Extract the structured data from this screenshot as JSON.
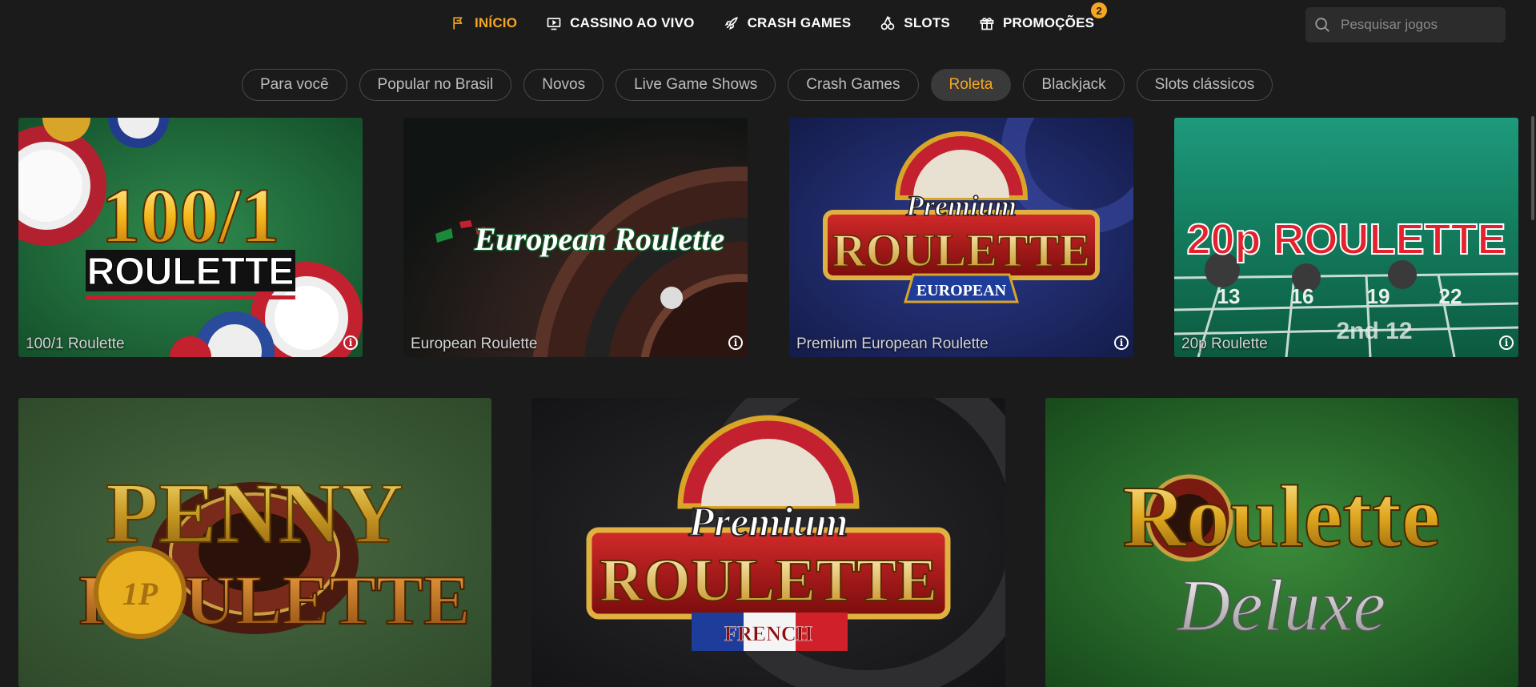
{
  "nav": {
    "items": [
      {
        "label": "INÍCIO",
        "icon": "flag-icon",
        "active": true
      },
      {
        "label": "CASSINO AO VIVO",
        "icon": "tv-icon"
      },
      {
        "label": "CRASH GAMES",
        "icon": "rocket-icon"
      },
      {
        "label": "SLOTS",
        "icon": "cherries-icon"
      },
      {
        "label": "PROMOÇÕES",
        "icon": "gift-icon",
        "badge": "2"
      }
    ]
  },
  "search": {
    "placeholder": "Pesquisar jogos",
    "icon": "search-icon"
  },
  "chips": [
    {
      "label": "Para você"
    },
    {
      "label": "Popular no Brasil"
    },
    {
      "label": "Novos"
    },
    {
      "label": "Live Game Shows"
    },
    {
      "label": "Crash Games"
    },
    {
      "label": "Roleta",
      "active": true
    },
    {
      "label": "Blackjack"
    },
    {
      "label": "Slots clássicos"
    }
  ],
  "games_row1": [
    {
      "name": "100/1 Roulette",
      "art_line1": "100/1",
      "art_line2": "ROULETTE"
    },
    {
      "name": "European Roulette",
      "art_line1": "European Roulette"
    },
    {
      "name": "Premium European Roulette",
      "art_line1": "Premium",
      "art_line2": "ROULETTE",
      "art_line3": "EUROPEAN"
    },
    {
      "name": "20p Roulette",
      "art_line1": "20p ROULETTE",
      "art_line2": "2nd 12",
      "art_nums": [
        "13",
        "16",
        "19",
        "22"
      ]
    }
  ],
  "games_row2": [
    {
      "art_line1": "PENNY",
      "art_line2": "ROULETTE",
      "art_coin": "1P"
    },
    {
      "art_line1": "Premium",
      "art_line2": "ROULETTE",
      "art_line3": "FRENCH"
    },
    {
      "art_line1": "Roulette",
      "art_line2": "Deluxe"
    }
  ],
  "info_symbol": "i",
  "colors": {
    "accent": "#f5a623",
    "background": "#1b1b1b",
    "chip_border": "#4a4a4a"
  }
}
